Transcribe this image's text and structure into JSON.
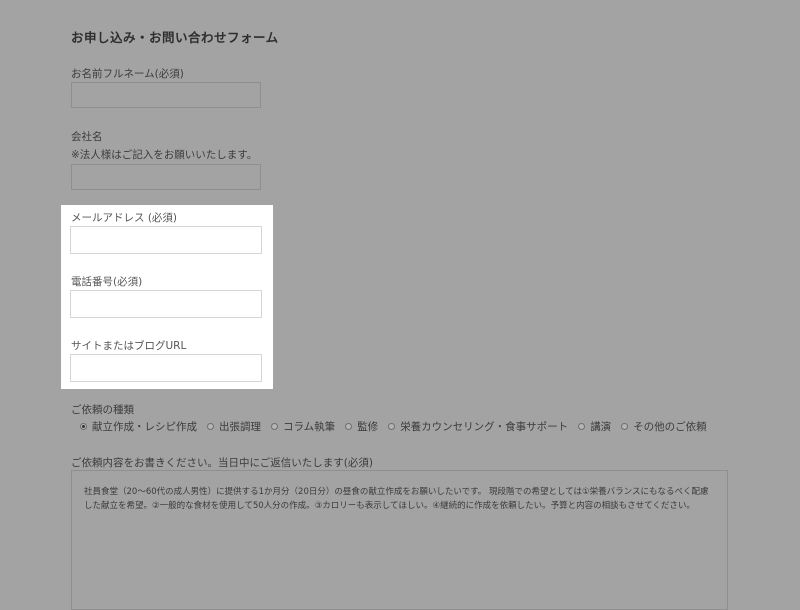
{
  "form": {
    "title": "お申し込み・お問い合わせフォーム",
    "name_label": "お名前フルネーム(必須)",
    "company_label": "会社名",
    "company_note": "※法人様はご記入をお願いいたします。",
    "email_label": "メールアドレス (必須)",
    "phone_label": "電話番号(必須)",
    "site_label": "サイトまたはブログURL",
    "request_type_label": "ご依頼の種類",
    "request_types": [
      {
        "label": "献立作成・レシピ作成",
        "checked": true
      },
      {
        "label": "出張調理",
        "checked": false
      },
      {
        "label": "コラム執筆",
        "checked": false
      },
      {
        "label": "監修",
        "checked": false
      },
      {
        "label": "栄養カウンセリング・食事サポート",
        "checked": false
      },
      {
        "label": "講演",
        "checked": false
      },
      {
        "label": "その他のご依頼",
        "checked": false
      }
    ],
    "details_label": "ご依頼内容をお書きください。当日中にご返信いたします(必須)",
    "details_value": "社員食堂（20〜60代の成人男性）に提供する1か月分（20日分）の昼食の献立作成をお願いしたいです。 現段階での希望としては①栄養バランスにもなるべく配慮した献立を希望。②一般的な食材を使用して50人分の作成。③カロリーも表示してほしい。④継続的に作成を依頼したい。予算と内容の相談もさせてください。"
  }
}
